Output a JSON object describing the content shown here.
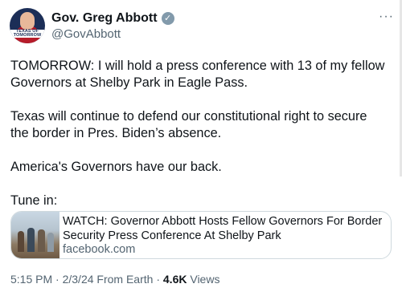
{
  "author": {
    "name": "Gov. Greg Abbott",
    "handle": "@GovAbbott",
    "avatar_banner": [
      "TEXAS OF",
      "TOMORROW"
    ]
  },
  "verified_badge": "✓",
  "more_icon": "···",
  "tweet_text": "TOMORROW: I will hold a press conference with 13 of my fellow Governors at Shelby Park in Eagle Pass.\n\nTexas will continue to defend our constitutional right to secure the border in Pres. Biden’s absence.\n\nAmerica's Governors have our back.\n\nTune in:",
  "link_card": {
    "title": "WATCH: Governor Abbott Hosts Fellow Governors For Border Security Press Conference At Shelby Park",
    "domain": "facebook.com"
  },
  "meta": {
    "time": "5:15 PM",
    "date": "2/3/24",
    "source": "From Earth",
    "views_count": "4.6K",
    "views_label": "Views"
  }
}
